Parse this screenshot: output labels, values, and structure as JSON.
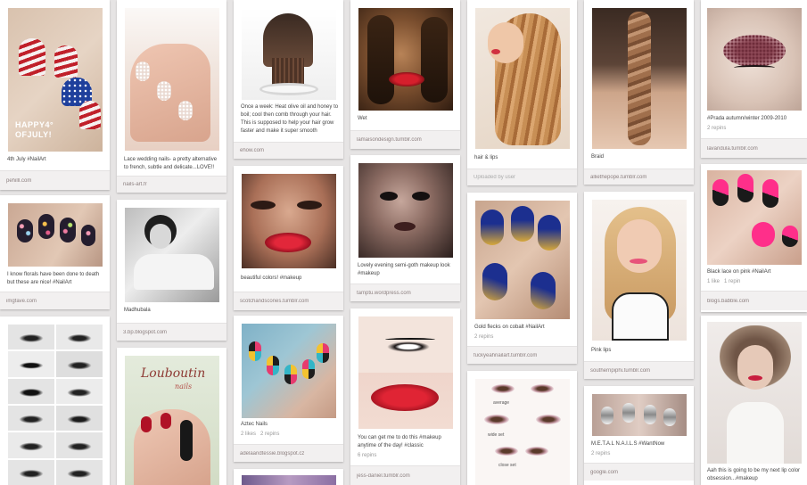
{
  "pins": [
    {
      "desc": "4th July #NailArt",
      "source": "pehilll.com",
      "overlay": "HAPPY4°\nOFJULY!"
    },
    {
      "desc": "I know florals have been done to death but these are nice! #NailArt",
      "source": "imgfave.com"
    },
    {
      "desc": "Lace wedding nails- a pretty alternative to french, subtle and delicate...LOVE!!",
      "source": "nails-art.fr"
    },
    {
      "desc": "Madhubala",
      "source": "3.bp.blogspot.com"
    },
    {
      "desc": "Once a week: Heat olive oil and honey to boil; cool then comb through your hair. This is supposed to help your hair grow faster and make it super smooth",
      "source": "ehow.com"
    },
    {
      "desc": "beautiful colors! #makeup",
      "source": "scotchandscones.tumblr.com"
    },
    {
      "desc": "Aztec Nails",
      "stats": "2 likes   2 repins",
      "source": "adelaandtessie.blogspot.cz"
    },
    {
      "desc": "Wet",
      "source": "lamaisondesign.tumblr.com"
    },
    {
      "desc": "Lovely evening semi-goth makeup look #makeup",
      "source": "tamptu.wordpress.com"
    },
    {
      "desc": "You can get me to do this #makeup anytime of the day! #classic",
      "stats": "6 repins",
      "source": "jess-daniel.tumblr.com"
    },
    {
      "desc": "hair & lips",
      "source": "Uploaded by user"
    },
    {
      "desc": "Gold flecks on cobalt #NailArt",
      "stats": "2 repins",
      "source": "fuckyeahnailart.tumblr.com"
    },
    {
      "desc": "Braid",
      "source": "alliethepope.tumblr.com"
    },
    {
      "desc": "Pink lips",
      "source": "southernpiphi.tumblr.com"
    },
    {
      "desc": "M.E.T.A.L N.A.I.L.S #WantNow",
      "stats": "2 repins",
      "source": "google.com"
    },
    {
      "desc": "#Prada autumn/winter 2009-2010",
      "stats": "2 repins",
      "source": "lavandula.tumblr.com"
    },
    {
      "desc": "Black lace on pink #NailArt",
      "stats": "1 like   1 repin",
      "source": "blogs.babble.com"
    },
    {
      "desc": "Aah this is going to be my next lip color obsession...#makeup"
    }
  ],
  "image_text": {
    "louboutin_title": "Louboutin",
    "louboutin_sub": "nails",
    "eye_labels": [
      "average",
      "wide set",
      "close set"
    ]
  },
  "colors": {
    "background": "#e6e4e4",
    "card": "#ffffff",
    "source_bar": "#f2f0f0",
    "source_text": "#8c7f7f"
  }
}
